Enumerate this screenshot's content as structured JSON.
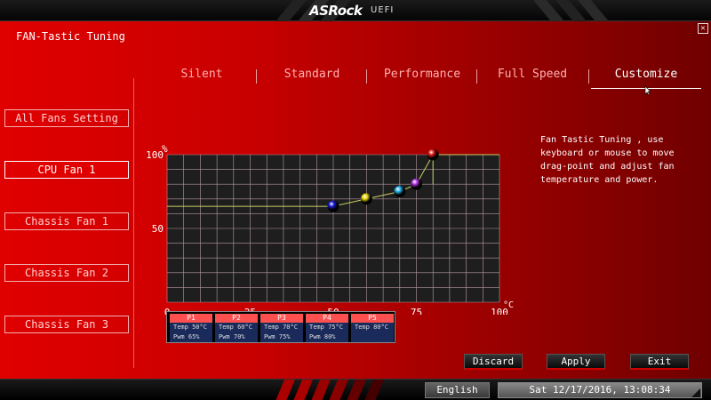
{
  "header": {
    "logo": "ASRock",
    "logo_suffix": "UEFI"
  },
  "page": {
    "title": "FAN-Tastic Tuning",
    "close_glyph": "✕"
  },
  "tabs": [
    {
      "label": "Silent",
      "active": false
    },
    {
      "label": "Standard",
      "active": false
    },
    {
      "label": "Performance",
      "active": false
    },
    {
      "label": "Full Speed",
      "active": false
    },
    {
      "label": "Customize",
      "active": true
    }
  ],
  "sidebar": {
    "items": [
      {
        "label": "All Fans Setting",
        "active": false
      },
      {
        "label": "CPU Fan 1",
        "active": true
      },
      {
        "label": "Chassis Fan 1",
        "active": false
      },
      {
        "label": "Chassis Fan 2",
        "active": false
      },
      {
        "label": "Chassis Fan 3",
        "active": false
      }
    ]
  },
  "chart_data": {
    "type": "line",
    "y_unit": "%",
    "x_unit": "°C",
    "x_ticks": [
      "0",
      "25",
      "50",
      "75",
      "100"
    ],
    "y_ticks": [
      "50",
      "100"
    ],
    "xlim": [
      0,
      100
    ],
    "ylim": [
      0,
      100
    ],
    "grid": true,
    "baseline_pwm": 65,
    "points": [
      {
        "name": "P1",
        "temp": 50,
        "pwm": 65,
        "color": "#1a1adc"
      },
      {
        "name": "P2",
        "temp": 60,
        "pwm": 70,
        "color": "#e8d400"
      },
      {
        "name": "P3",
        "temp": 70,
        "pwm": 75,
        "color": "#20b0e8"
      },
      {
        "name": "P4",
        "temp": 75,
        "pwm": 80,
        "color": "#b030e0"
      },
      {
        "name": "P5",
        "temp": 80,
        "pwm": 100,
        "color": "#e01818"
      }
    ]
  },
  "help_text": "Fan Tastic Tuning , use keyboard or mouse to move drag-point and adjust fan temperature and power.",
  "point_table": [
    {
      "title": "P1",
      "temp": "Temp 50°C",
      "pwm": "Pwm  65%"
    },
    {
      "title": "P2",
      "temp": "Temp 60°C",
      "pwm": "Pwm  70%"
    },
    {
      "title": "P3",
      "temp": "Temp 70°C",
      "pwm": "Pwm  75%"
    },
    {
      "title": "P4",
      "temp": "Temp 75°C",
      "pwm": "Pwm  80%"
    },
    {
      "title": "P5",
      "temp": "Temp 80°C",
      "pwm": ""
    }
  ],
  "actions": {
    "discard": "Discard",
    "apply": "Apply",
    "exit": "Exit"
  },
  "footer": {
    "language": "English",
    "datetime": "Sat 12/17/2016, 13:08:34"
  },
  "colors": {
    "accent": "#e00000",
    "grid": "#b89aa0",
    "curve": "#c8d060"
  }
}
